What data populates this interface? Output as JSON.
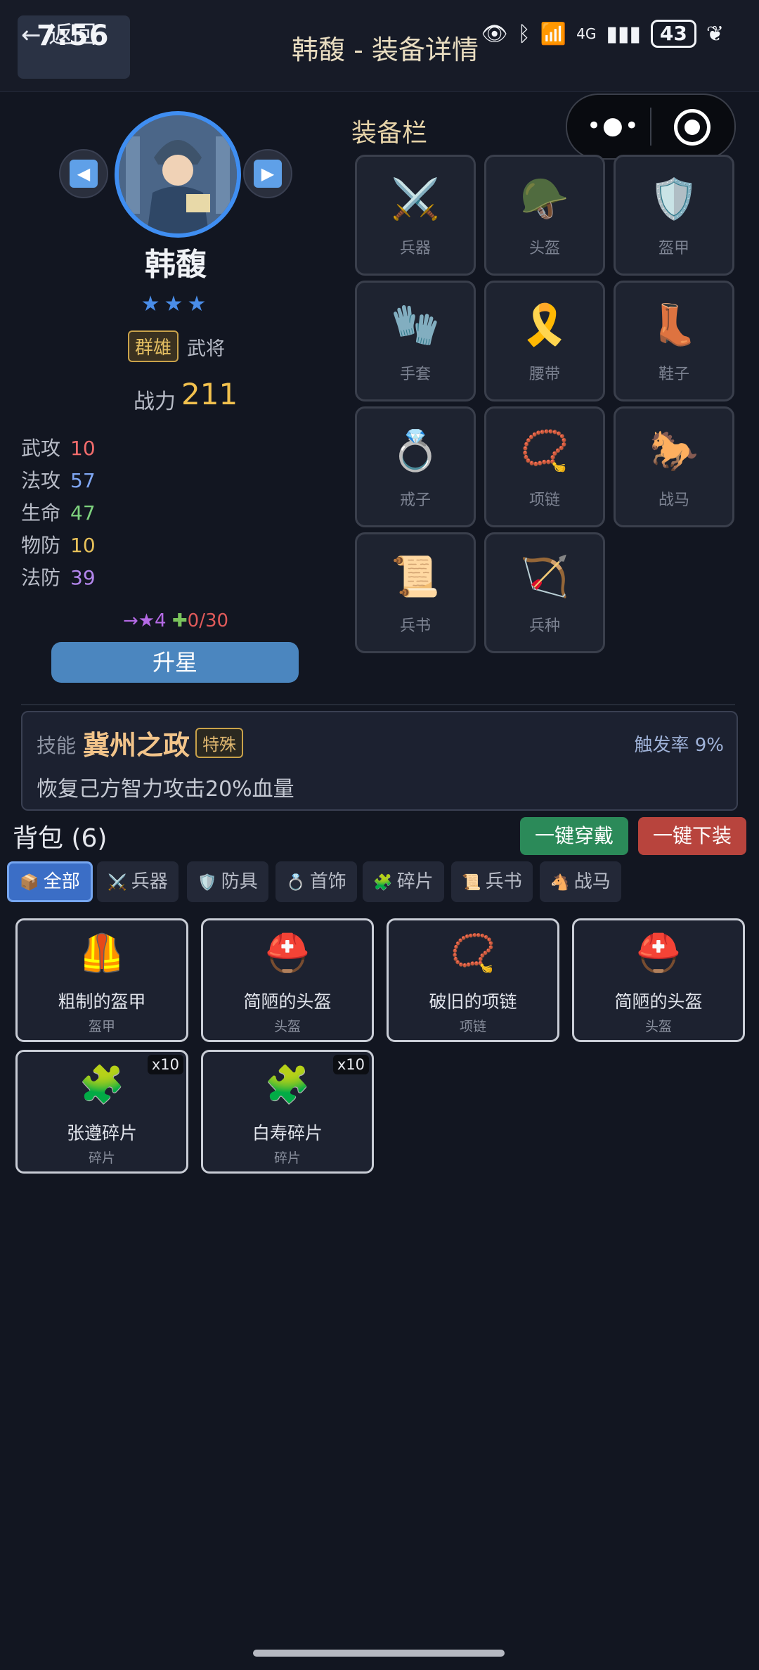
{
  "status_bar": {
    "time": "7:56",
    "battery": "43",
    "network": "4G"
  },
  "header": {
    "back_label": "← 返回",
    "title": "韩馥 - 装备详情"
  },
  "hero": {
    "name": "韩馥",
    "stars": "★★★",
    "faction": "群雄",
    "role": "武将",
    "power_label": "战力",
    "power_value": "211",
    "stats": [
      {
        "label": "武攻",
        "value": "10",
        "color": "#f26c6c"
      },
      {
        "label": "法攻",
        "value": "57",
        "color": "#7fa6f2"
      },
      {
        "label": "生命",
        "value": "47",
        "color": "#7ed27e"
      },
      {
        "label": "物防",
        "value": "10",
        "color": "#e7c15a"
      },
      {
        "label": "法防",
        "value": "39",
        "color": "#b386ec"
      }
    ],
    "upgrade_target": "→★4",
    "upgrade_progress": "0/30",
    "upgrade_button": "升星"
  },
  "equipment": {
    "title": "装备栏",
    "slots": [
      {
        "label": "兵器",
        "icon": "⚔️"
      },
      {
        "label": "头盔",
        "icon": "🪖"
      },
      {
        "label": "盔甲",
        "icon": "🛡️"
      },
      {
        "label": "手套",
        "icon": "🧤"
      },
      {
        "label": "腰带",
        "icon": "🎗️"
      },
      {
        "label": "鞋子",
        "icon": "👢"
      },
      {
        "label": "戒子",
        "icon": "💍"
      },
      {
        "label": "项链",
        "icon": "📿"
      },
      {
        "label": "战马",
        "icon": "🐎"
      },
      {
        "label": "兵书",
        "icon": "📜"
      },
      {
        "label": "兵种",
        "icon": "🏹"
      }
    ]
  },
  "skill": {
    "label": "技能",
    "name": "冀州之政",
    "tag": "特殊",
    "trigger_rate": "触发率 9%",
    "description": "恢复己方智力攻击20%血量"
  },
  "backpack": {
    "title": "背包 (6)",
    "equip_all": "一键穿戴",
    "unequip_all": "一键下装",
    "tabs": [
      {
        "label": "全部",
        "icon": "📦",
        "active": true
      },
      {
        "label": "兵器",
        "icon": "⚔️"
      },
      {
        "label": "防具",
        "icon": "🛡️"
      },
      {
        "label": "首饰",
        "icon": "💍"
      },
      {
        "label": "碎片",
        "icon": "🧩"
      },
      {
        "label": "兵书",
        "icon": "📜"
      },
      {
        "label": "战马",
        "icon": "🐴"
      }
    ],
    "items": [
      {
        "name": "粗制的盔甲",
        "type": "盔甲",
        "icon": "🦺",
        "count": ""
      },
      {
        "name": "简陋的头盔",
        "type": "头盔",
        "icon": "⛑️",
        "count": ""
      },
      {
        "name": "破旧的项链",
        "type": "项链",
        "icon": "📿",
        "count": ""
      },
      {
        "name": "简陋的头盔",
        "type": "头盔",
        "icon": "⛑️",
        "count": ""
      },
      {
        "name": "张遵碎片",
        "type": "碎片",
        "icon": "🧩",
        "count": "x10"
      },
      {
        "name": "白寿碎片",
        "type": "碎片",
        "icon": "🧩",
        "count": "x10"
      }
    ]
  },
  "colors": {
    "accent": "#3f8ef2",
    "gold": "#f2c14e",
    "equip_btn": "#2b8a59",
    "unequip_btn": "#b8443d"
  }
}
